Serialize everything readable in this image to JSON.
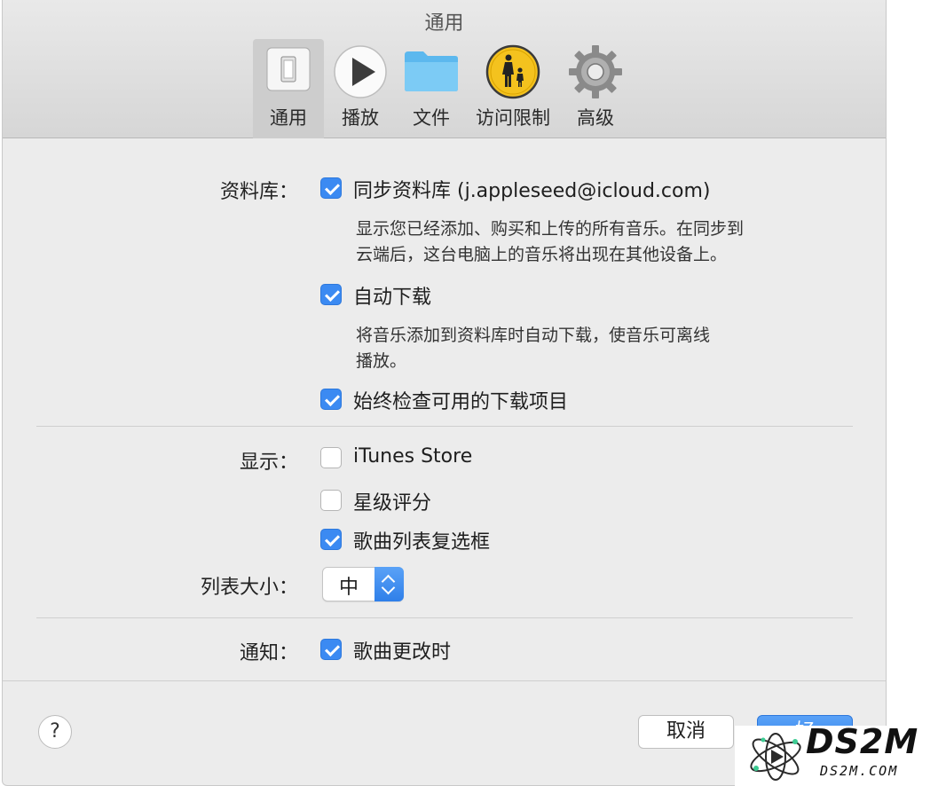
{
  "window": {
    "title": "通用"
  },
  "toolbar": {
    "items": [
      {
        "label": "通用",
        "icon": "switch-icon",
        "selected": true
      },
      {
        "label": "播放",
        "icon": "play-icon",
        "selected": false
      },
      {
        "label": "文件",
        "icon": "folder-icon",
        "selected": false
      },
      {
        "label": "访问限制",
        "icon": "parental-controls-icon",
        "selected": false
      },
      {
        "label": "高级",
        "icon": "gear-icon",
        "selected": false
      }
    ]
  },
  "library": {
    "label": "资料库：",
    "sync": {
      "label": "同步资料库 (j.appleseed@icloud.com)",
      "checked": true
    },
    "sync_desc_1": "显示您已经添加、购买和上传的所有音乐。在同步到",
    "sync_desc_2": "云端后，这台电脑上的音乐将出现在其他设备上。",
    "auto_download": {
      "label": "自动下载",
      "checked": true
    },
    "auto_desc_1": "将音乐添加到资料库时自动下载，使音乐可离线",
    "auto_desc_2": "播放。",
    "check_downloads": {
      "label": "始终检查可用的下载项目",
      "checked": true
    }
  },
  "display": {
    "label": "显示：",
    "itunes_store": {
      "label": "iTunes Store",
      "checked": false
    },
    "star_ratings": {
      "label": "星级评分",
      "checked": false
    },
    "song_checkboxes": {
      "label": "歌曲列表复选框",
      "checked": true
    }
  },
  "list_size": {
    "label": "列表大小：",
    "value": "中"
  },
  "notifications": {
    "label": "通知：",
    "song_change": {
      "label": "歌曲更改时",
      "checked": true
    }
  },
  "footer": {
    "help_label": "?",
    "cancel_label": "取消",
    "ok_label": "好"
  },
  "watermark": {
    "big": "DS2M",
    "small": "DS2M.COM"
  },
  "colors": {
    "accent": "#3b8af2",
    "window_bg": "#ececec"
  }
}
